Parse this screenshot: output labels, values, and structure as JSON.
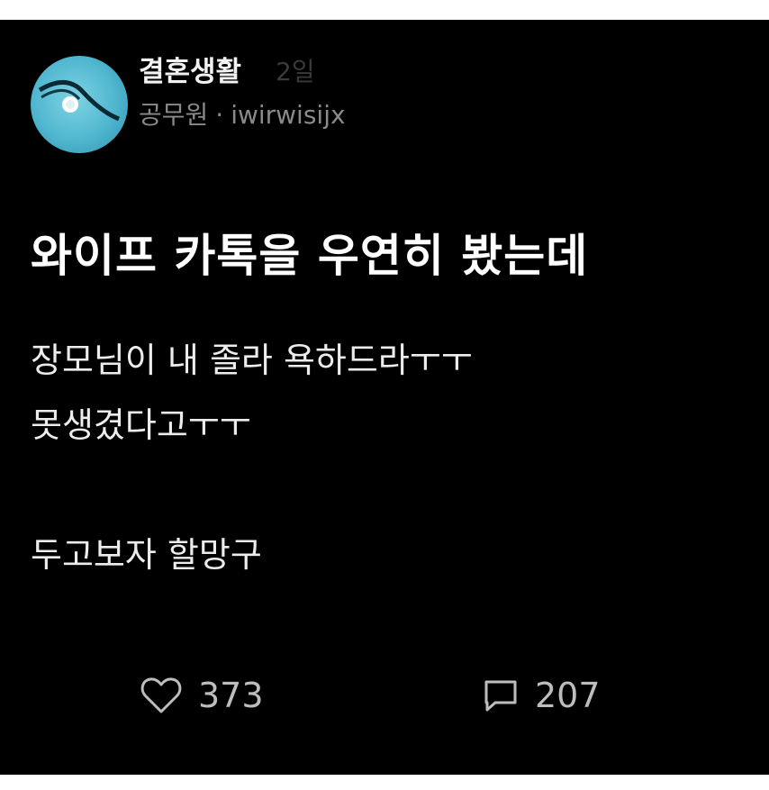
{
  "post": {
    "community": "결혼생활",
    "time": "2일",
    "author_job": "공무원",
    "separator": "·",
    "author_id": "iwirwisijx",
    "title": "와이프 카톡을 우연히 봤는데",
    "body_lines": [
      "장모님이 내 졸라 욕하드라ㅜㅜ",
      "못생겼다고ㅜㅜ",
      "",
      "두고보자 할망구"
    ],
    "likes": "373",
    "comments": "207"
  },
  "icons": {
    "like": "heart-icon",
    "comment": "comment-icon"
  },
  "colors": {
    "background": "#000000",
    "text": "#ffffff",
    "muted": "#8a8a8a",
    "avatar": "#4fb6cf"
  }
}
